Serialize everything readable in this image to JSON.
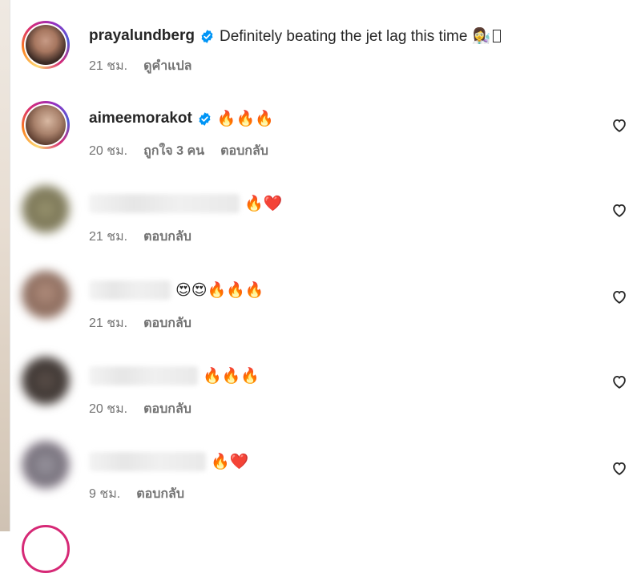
{
  "comments": [
    {
      "username": "prayalundberg",
      "verified": true,
      "text": "Definitely beating the jet lag this time 👩‍🔬",
      "time": "21 ชม.",
      "translate_label": "ดูคำแปล",
      "avatar_colors": [
        "#3b2a24",
        "#c79a85"
      ]
    },
    {
      "username": "aimeemorakot",
      "verified": true,
      "text": "🔥🔥🔥",
      "time": "20 ชม.",
      "likes_label": "ถูกใจ 3 คน",
      "reply_label": "ตอบกลับ",
      "avatar_colors": [
        "#5a3a2c",
        "#d8b8a2"
      ]
    },
    {
      "username_blurred": true,
      "text": "🔥❤️",
      "time": "21 ชม.",
      "reply_label": "ตอบกลับ",
      "avatar_colors": [
        "#7a7556",
        "#c9c6a8"
      ]
    },
    {
      "username_blurred": true,
      "text": "😍😍🔥🔥🔥",
      "time": "21 ชม.",
      "reply_label": "ตอบกลับ",
      "avatar_colors": [
        "#8a6a5c",
        "#d3b6a6"
      ]
    },
    {
      "username_blurred": true,
      "text": "🔥🔥🔥",
      "time": "20 ชม.",
      "reply_label": "ตอบกลับ",
      "avatar_colors": [
        "#3c3532",
        "#a28f85"
      ]
    },
    {
      "username_blurred": true,
      "text": "🔥❤️",
      "time": "9 ชม.",
      "reply_label": "ตอบกลับ",
      "avatar_colors": [
        "#75707a",
        "#d6cfd3"
      ]
    }
  ],
  "icons": {
    "verified": "verified-badge-icon",
    "like": "heart-outline-icon"
  },
  "colors": {
    "verified_blue": "#0095f6",
    "meta_gray": "#737373",
    "text": "#262626"
  }
}
